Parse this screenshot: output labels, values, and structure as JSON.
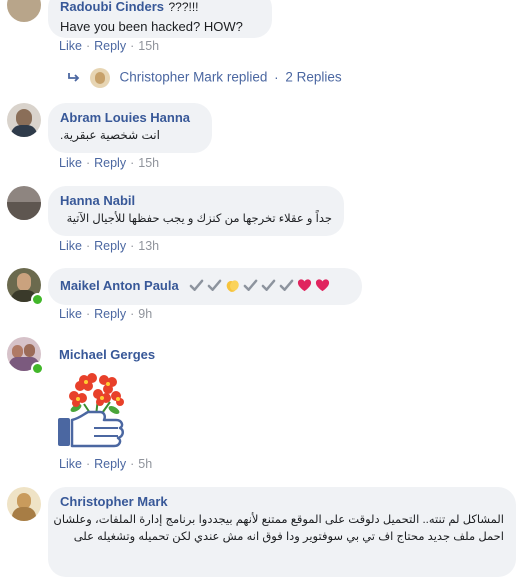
{
  "comments": [
    {
      "author": "Radoubi Cinders",
      "author_suffix": "???!!!",
      "text": "Have you been hacked? HOW?",
      "actions": {
        "like": "Like",
        "reply": "Reply",
        "time": "15h"
      }
    },
    {
      "replied": {
        "author": "Christopher Mark",
        "verb": "replied",
        "sep": "·",
        "count": "2 Replies"
      }
    },
    {
      "author": "Abram Louies Hanna",
      "text": "انت شخصية عبقرية.",
      "actions": {
        "like": "Like",
        "reply": "Reply",
        "time": "15h"
      }
    },
    {
      "author": "Hanna Nabil",
      "text": "جداً و عقلاء تخرجها من كنزك و يجب حفظها للأجيال الآتية",
      "actions": {
        "like": "Like",
        "reply": "Reply",
        "time": "13h"
      }
    },
    {
      "author": "Maikel Anton Paula",
      "emojis": [
        "check-mark-icon",
        "check-mark-icon",
        "clapping-hands-icon",
        "check-mark-icon",
        "check-mark-icon",
        "check-mark-icon",
        "red-heart-icon",
        "red-heart-icon"
      ],
      "actions": {
        "like": "Like",
        "reply": "Reply",
        "time": "9h"
      }
    },
    {
      "author": "Michael Gerges",
      "sticker": "thumbs-up-flowers-sticker",
      "actions": {
        "like": "Like",
        "reply": "Reply",
        "time": "5h"
      }
    },
    {
      "author": "Christopher Mark",
      "text_lines": [
        "المشاكل لم تنته.. التحميل دلوقت على الموقع ممتنع لأنهم بيجددوا برنامج إدارة الملفات، وعلشان",
        "احمل ملف جديد محتاج اف تي بي سوفتوير ودا فوق انه مش عندي لكن تحميله وتشغيله على"
      ]
    }
  ],
  "colors": {
    "link": "#385898",
    "bubble": "#f0f2f5",
    "online": "#42b72a",
    "heart": "#e0245e",
    "check": "#8d949e"
  }
}
